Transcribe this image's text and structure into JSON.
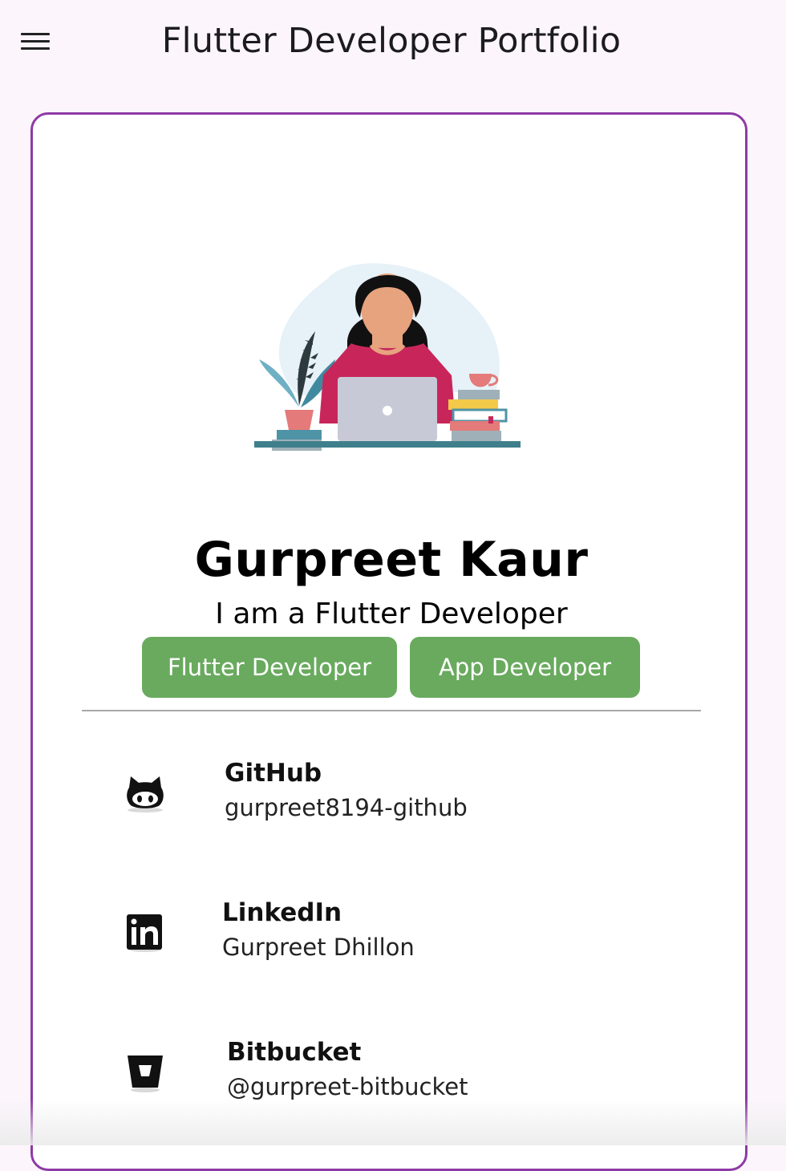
{
  "appbar": {
    "title": "Flutter Developer Portfolio",
    "menu_icon": "hamburger-menu-icon"
  },
  "profile": {
    "name": "Gurpreet Kaur",
    "tagline": "I am a Flutter Developer",
    "chips": [
      "Flutter Developer",
      "App Developer"
    ],
    "illustration": "woman-at-laptop-illustration"
  },
  "contacts": [
    {
      "label": "GitHub",
      "value": "gurpreet8194-github",
      "icon": "github-icon"
    },
    {
      "label": "LinkedIn",
      "value": "Gurpreet Dhillon",
      "icon": "linkedin-icon"
    },
    {
      "label": "Bitbucket",
      "value": "@gurpreet-bitbucket",
      "icon": "bitbucket-icon"
    }
  ],
  "colors": {
    "background": "#fcf6fc",
    "card_border": "#8e3aa6",
    "chip": "#69aa5e",
    "sweater": "#c8265a",
    "shelf": "#3f7f8c"
  }
}
